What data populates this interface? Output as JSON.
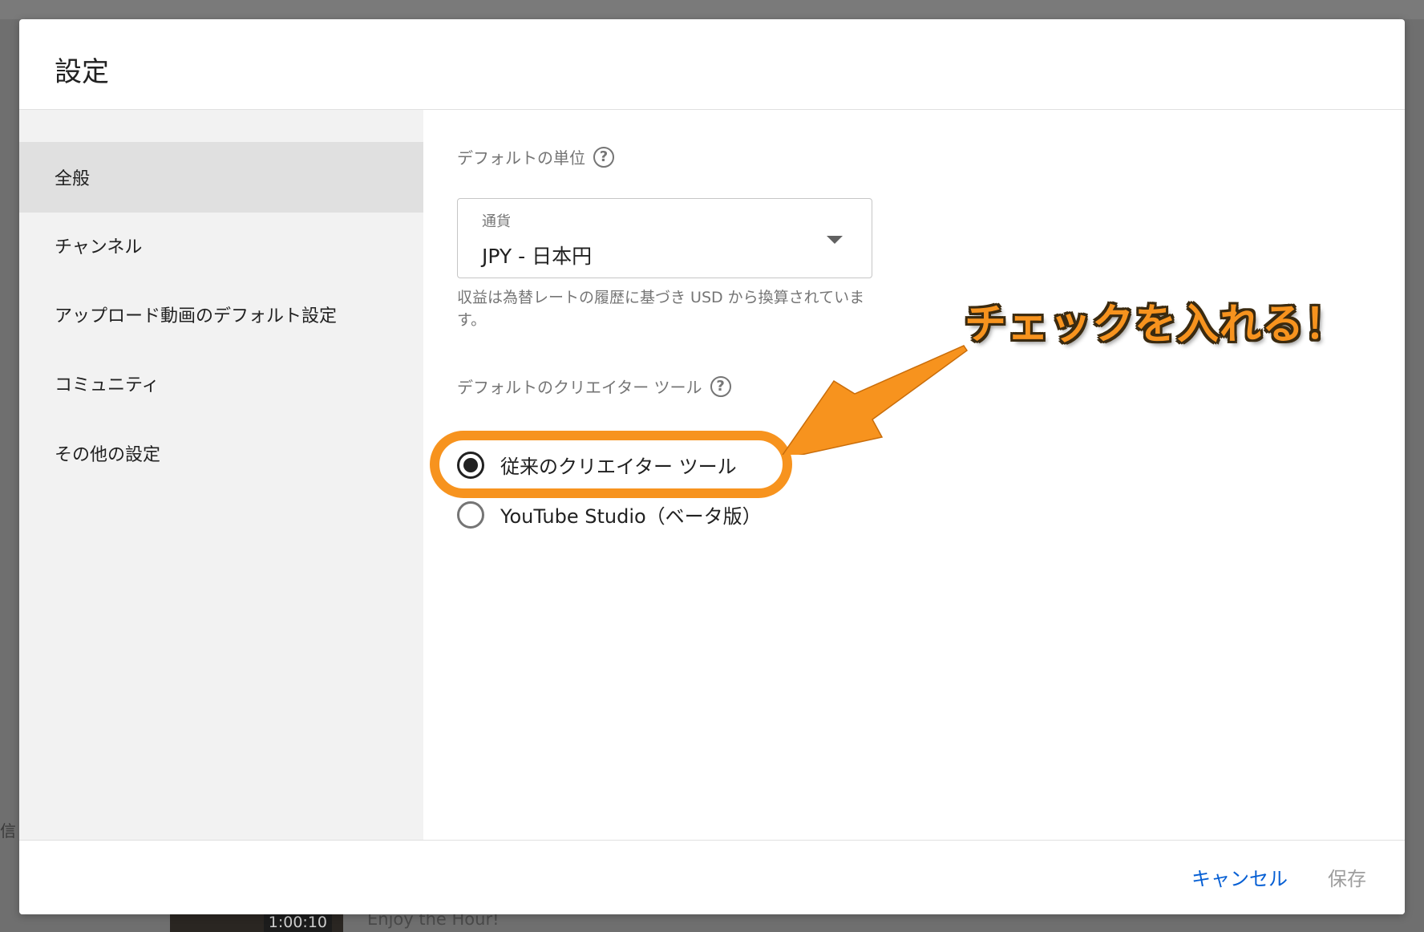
{
  "background": {
    "thumbnail_duration": "1:00:10",
    "video_title": "Enjoy the Hour!",
    "edge_char": "信"
  },
  "dialog": {
    "title": "設定"
  },
  "sidebar": {
    "items": [
      {
        "label": "全般",
        "active": true
      },
      {
        "label": "チャンネル",
        "active": false
      },
      {
        "label": "アップロード動画のデフォルト設定",
        "active": false
      },
      {
        "label": "コミュニティ",
        "active": false
      },
      {
        "label": "その他の設定",
        "active": false
      }
    ]
  },
  "general": {
    "default_unit_label": "デフォルトの単位",
    "currency": {
      "label": "通貨",
      "value": "JPY - 日本円",
      "helper": "収益は為替レートの履歴に基づき USD から換算されています。"
    },
    "creator_tool": {
      "label": "デフォルトのクリエイター ツール",
      "options": [
        {
          "label": "従来のクリエイター ツール",
          "checked": true
        },
        {
          "label": "YouTube Studio（ベータ版）",
          "checked": false
        }
      ]
    }
  },
  "annotation": {
    "text": "チェックを入れる！",
    "color": "#f7931e"
  },
  "footer": {
    "cancel_label": "キャンセル",
    "save_label": "保存"
  },
  "colors": {
    "accent_link": "#065fd4",
    "sidebar_bg": "#f2f2f2",
    "sidebar_active_bg": "#e0e0e0"
  }
}
